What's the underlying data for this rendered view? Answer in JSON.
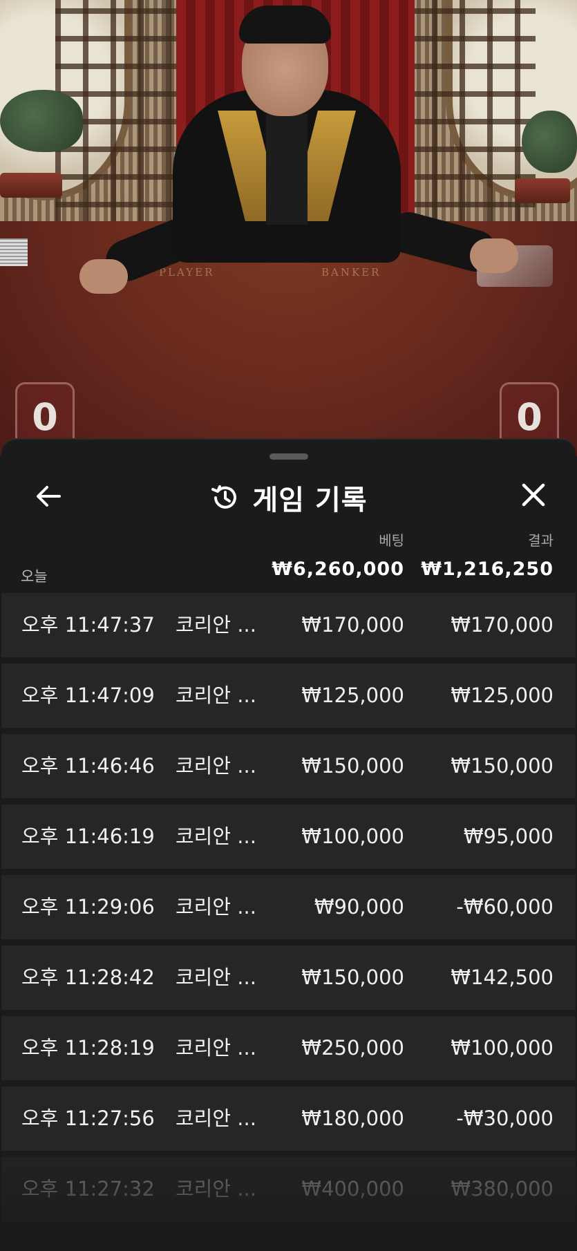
{
  "video": {
    "felt_player_label": "PLAYER",
    "felt_banker_label": "BANKER",
    "player_score": "0",
    "banker_score": "0"
  },
  "sheet": {
    "title": "게임 기록",
    "title_icon": "history-icon",
    "back_icon": "arrow-left-icon",
    "close_icon": "close-icon",
    "columns": {
      "bet": "베팅",
      "result": "결과"
    },
    "today_label": "오늘",
    "total_bet": "₩6,260,000",
    "total_result": "₩1,216,250",
    "rows": [
      {
        "time": "오후 11:47:37",
        "game": "코리안 ...",
        "bet": "₩170,000",
        "result": "₩170,000"
      },
      {
        "time": "오후 11:47:09",
        "game": "코리안 ...",
        "bet": "₩125,000",
        "result": "₩125,000"
      },
      {
        "time": "오후 11:46:46",
        "game": "코리안 ...",
        "bet": "₩150,000",
        "result": "₩150,000"
      },
      {
        "time": "오후 11:46:19",
        "game": "코리안 ...",
        "bet": "₩100,000",
        "result": "₩95,000"
      },
      {
        "time": "오후 11:29:06",
        "game": "코리안 ...",
        "bet": "₩90,000",
        "result": "-₩60,000"
      },
      {
        "time": "오후 11:28:42",
        "game": "코리안 ...",
        "bet": "₩150,000",
        "result": "₩142,500"
      },
      {
        "time": "오후 11:28:19",
        "game": "코리안 ...",
        "bet": "₩250,000",
        "result": "₩100,000"
      },
      {
        "time": "오후 11:27:56",
        "game": "코리안 ...",
        "bet": "₩180,000",
        "result": "-₩30,000"
      },
      {
        "time": "오후 11:27:32",
        "game": "코리안 ...",
        "bet": "₩400,000",
        "result": "₩380,000"
      }
    ]
  },
  "colors": {
    "sheet_background": "#1b1b1b",
    "row_background": "#262626",
    "text_primary": "#ffffff",
    "text_secondary": "#a9a9a9"
  }
}
